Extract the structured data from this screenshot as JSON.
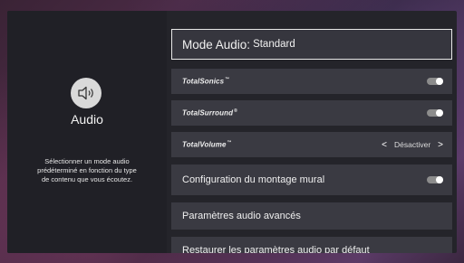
{
  "left": {
    "title": "Audio",
    "description_lines": [
      "Sélectionner un mode audio",
      "prédéterminé en fonction du type",
      "de contenu que vous écoutez."
    ],
    "icon": "speaker-icon"
  },
  "menu": {
    "audio_mode": {
      "label": "Mode Audio:",
      "value": "Standard"
    },
    "total_sonics": {
      "brand_a": "Total",
      "brand_b": "Sonics",
      "mark": "™",
      "toggle_on": false
    },
    "total_surround": {
      "brand_a": "Total",
      "brand_b": "Surround",
      "mark": "®",
      "toggle_on": false
    },
    "total_volume": {
      "brand_a": "Total",
      "brand_b": "Volume",
      "mark": "™",
      "value": "Désactiver",
      "prev": "<",
      "next": ">"
    },
    "wall_mount": {
      "label": "Configuration du montage mural",
      "toggle_on": false
    },
    "advanced": {
      "label": "Paramètres audio avancés"
    },
    "restore": {
      "label": "Restaurer les paramètres audio par défaut"
    }
  }
}
